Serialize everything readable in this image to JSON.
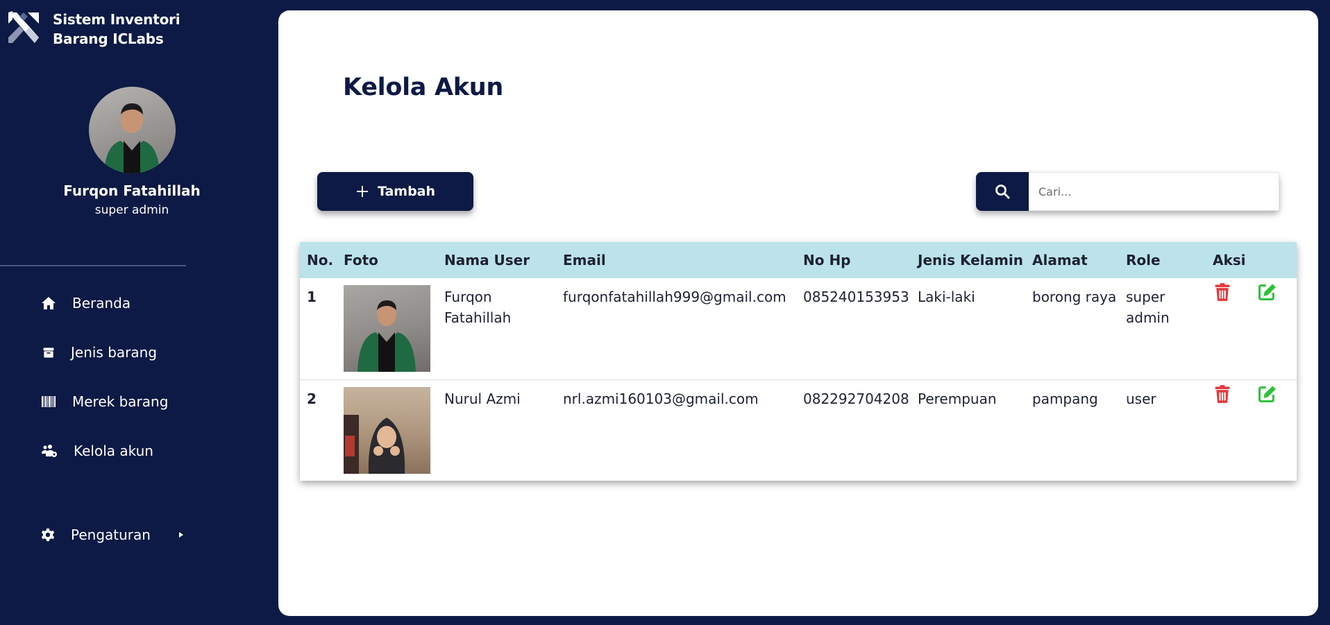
{
  "brand": {
    "line1": "Sistem Inventori",
    "line2": "Barang ICLabs"
  },
  "profile": {
    "name": "Furqon Fatahillah",
    "role": "super admin"
  },
  "nav": {
    "items": [
      {
        "label": "Beranda",
        "icon": "home-icon"
      },
      {
        "label": "Jenis barang",
        "icon": "box-icon"
      },
      {
        "label": "Merek barang",
        "icon": "barcode-icon"
      },
      {
        "label": "Kelola akun",
        "icon": "users-cog-icon"
      }
    ],
    "settings": {
      "label": "Pengaturan",
      "icon": "gear-icon"
    }
  },
  "main": {
    "title": "Kelola Akun",
    "add_button": "Tambah",
    "search_placeholder": "Cari..."
  },
  "table": {
    "headers": [
      "No.",
      "Foto",
      "Nama User",
      "Email",
      "No Hp",
      "Jenis Kelamin",
      "Alamat",
      "Role",
      "Aksi"
    ],
    "rows": [
      {
        "no": "1",
        "name": "Furqon Fatahillah",
        "email": "furqonfatahillah999@gmail.com",
        "phone": "085240153953",
        "gender": "Laki-laki",
        "address": "borong raya",
        "role": "super admin"
      },
      {
        "no": "2",
        "name": "Nurul Azmi",
        "email": "nrl.azmi160103@gmail.com",
        "phone": "082292704208",
        "gender": "Perempuan",
        "address": "pampang",
        "role": "user"
      }
    ]
  },
  "colors": {
    "navy": "#0d1a45",
    "header_bg": "#bce3ea",
    "delete": "#e0393e",
    "edit": "#2fc13b"
  }
}
